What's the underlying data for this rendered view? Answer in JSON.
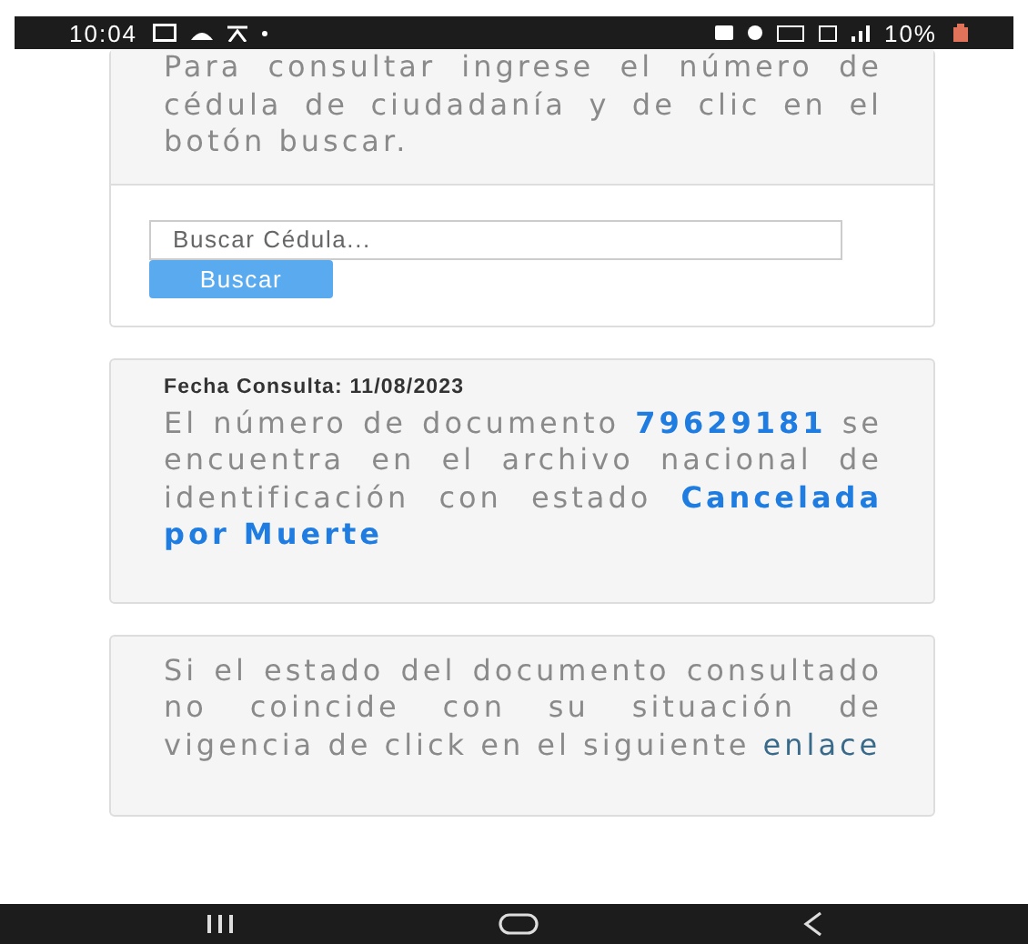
{
  "status_bar": {
    "time": "10:04",
    "battery": "10%"
  },
  "search_card": {
    "instructions": "Para consultar ingrese el número de cédula de ciudadanía y de clic en el botón buscar.",
    "search": {
      "placeholder": "Buscar Cédula..."
    },
    "button": "Buscar"
  },
  "result_card": {
    "date": "Fecha Consulta: 11/08/2023",
    "message": "El número de documento **79629181** se encuentra en el archivo nacional de identificación con estado **Cancelada por Muerte**"
  },
  "note_card": {
    "text": "Si el estado del documento consultado no coincide con su situación de vigencia de click en el siguiente",
    "link": "enlace"
  }
}
